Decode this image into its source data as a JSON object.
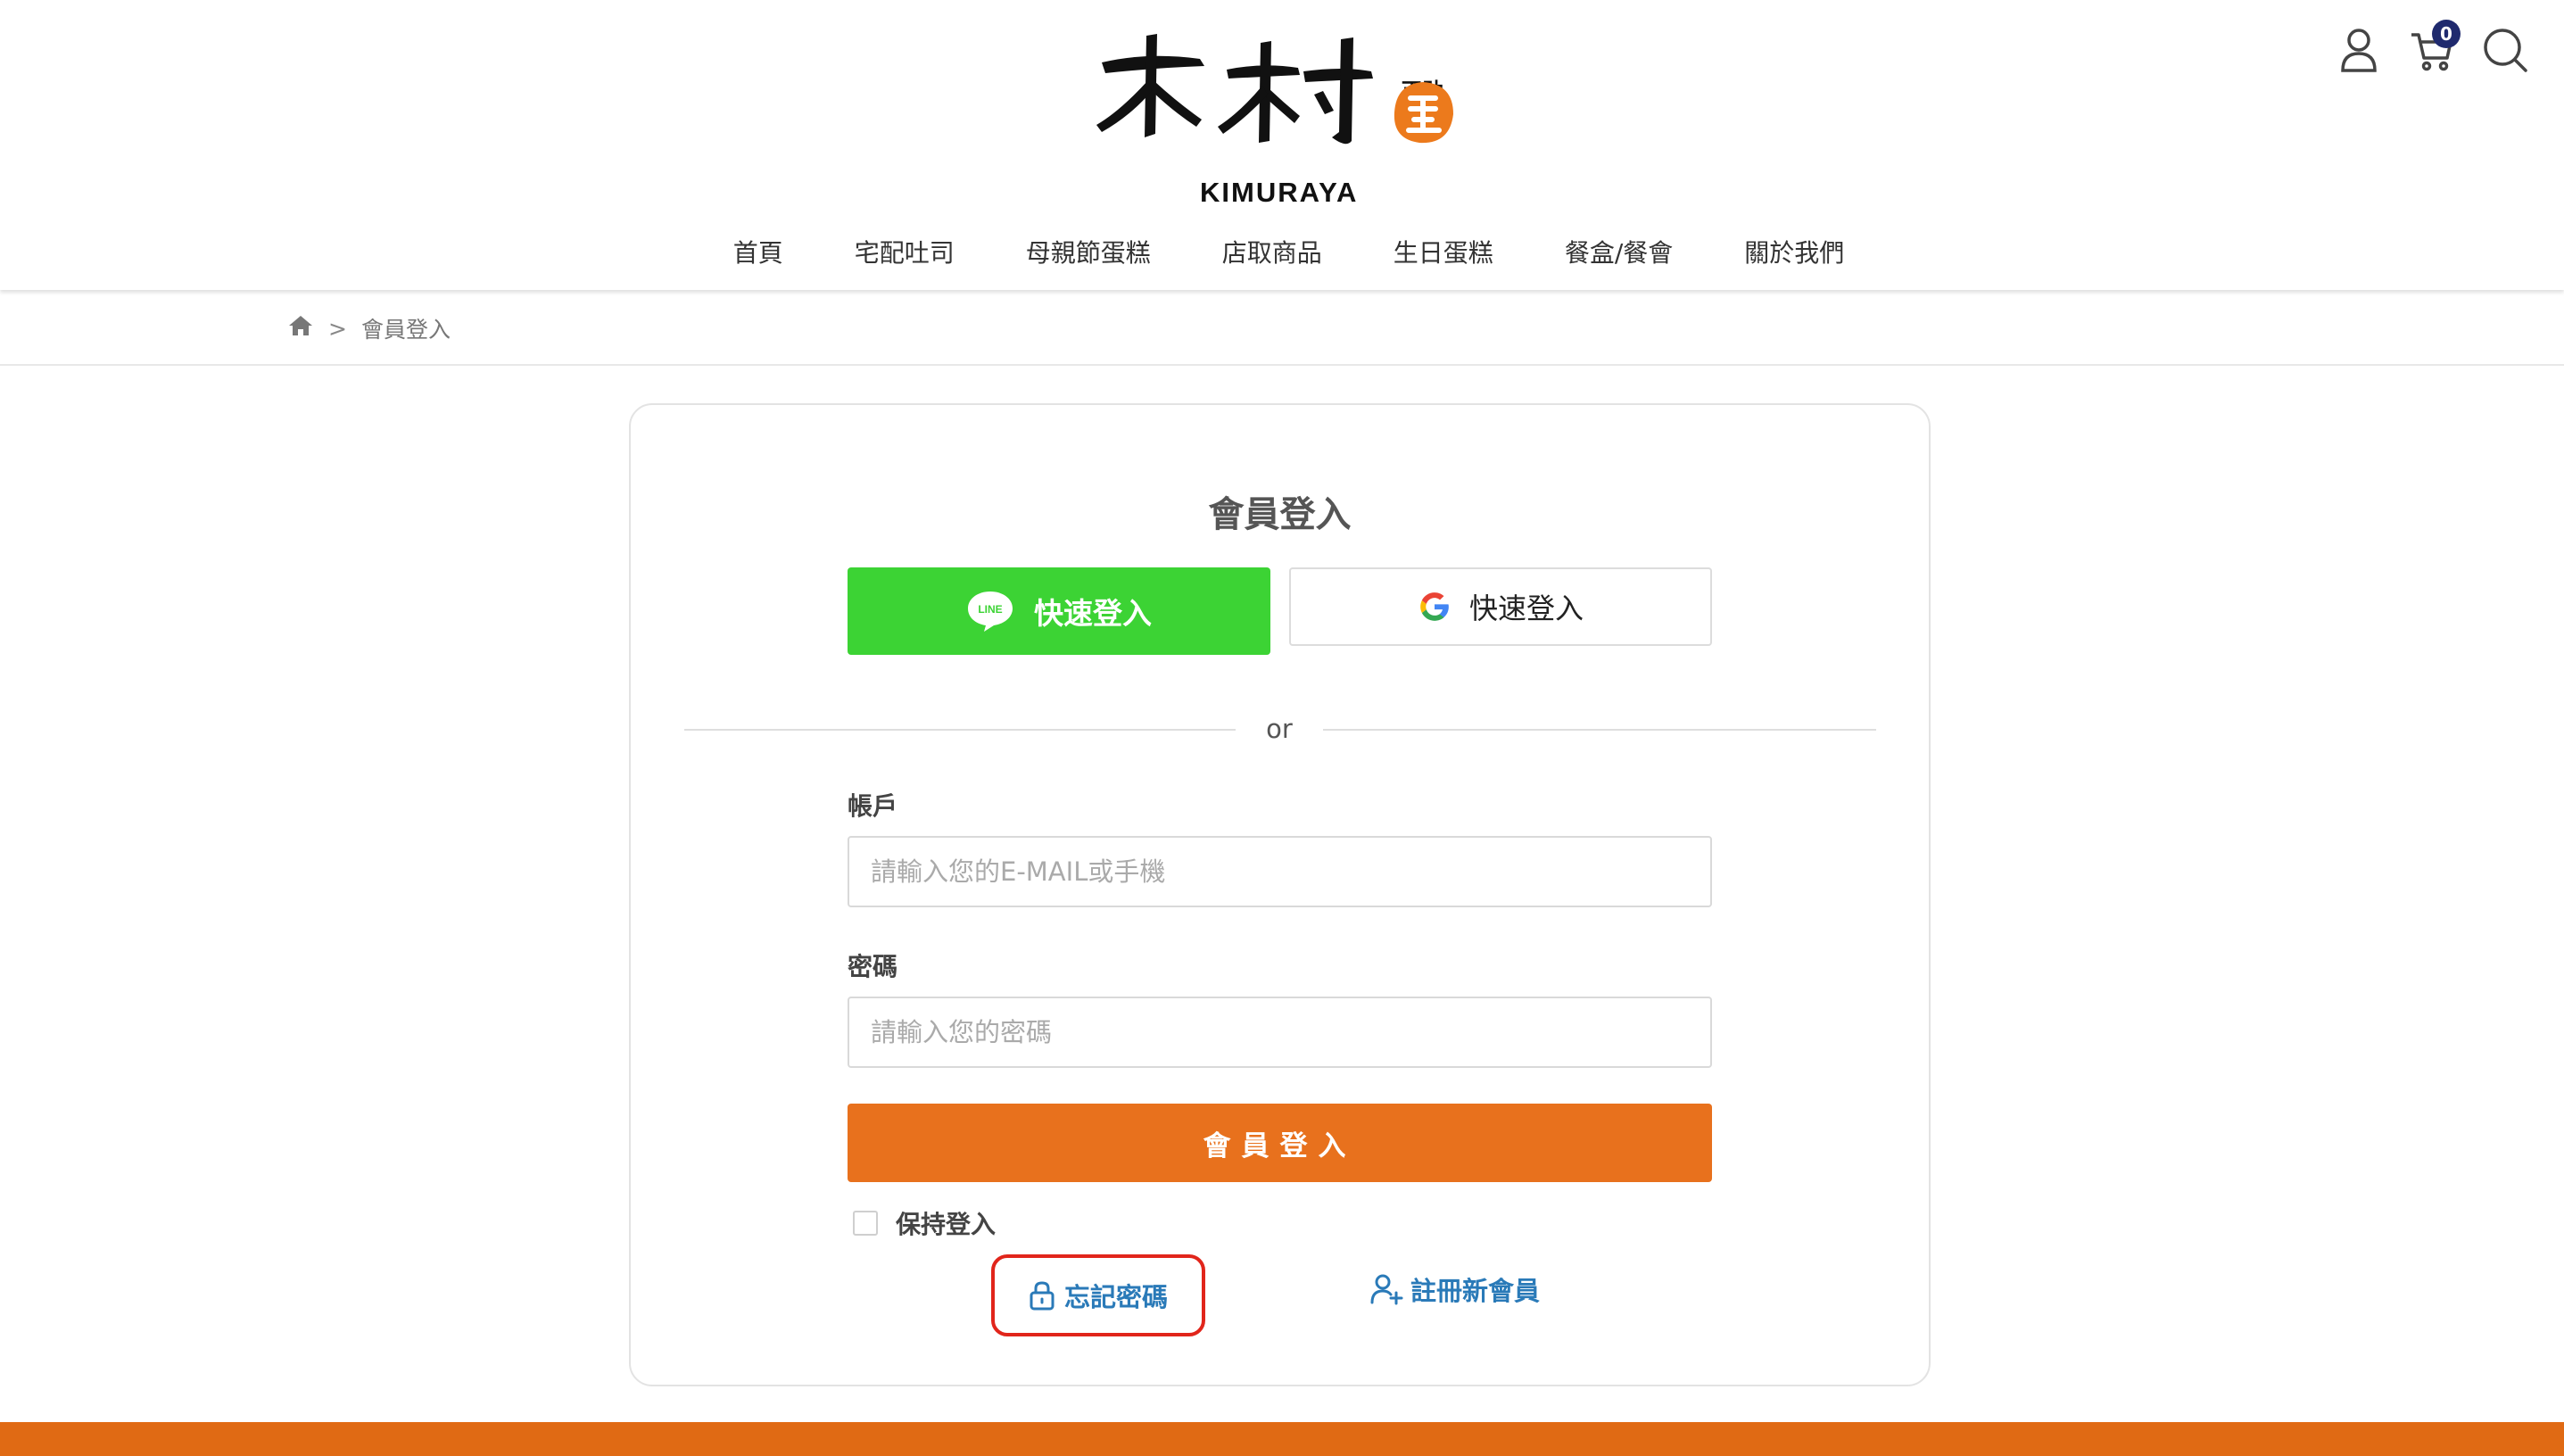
{
  "brand": {
    "logo_text": "KIMURAYA",
    "logo_small": "正助"
  },
  "header": {
    "cart_count": "0",
    "icons": [
      "user-icon",
      "cart-icon",
      "search-icon"
    ]
  },
  "nav": {
    "items": [
      {
        "label": "首頁"
      },
      {
        "label": "宅配吐司"
      },
      {
        "label": "母親節蛋糕"
      },
      {
        "label": "店取商品"
      },
      {
        "label": "生日蛋糕"
      },
      {
        "label": "餐盒/餐會"
      },
      {
        "label": "關於我們"
      }
    ]
  },
  "breadcrumb": {
    "separator": ">",
    "current": "會員登入"
  },
  "login": {
    "title": "會員登入",
    "line_button": "快速登入",
    "google_button": "快速登入",
    "divider": "or",
    "account_label": "帳戶",
    "account_placeholder": "請輸入您的E-MAIL或手機",
    "password_label": "密碼",
    "password_placeholder": "請輸入您的密碼",
    "submit": "會員登入",
    "keep_login": "保持登入",
    "forgot": "忘記密碼",
    "register": "註冊新會員"
  },
  "colors": {
    "line_green": "#3cd334",
    "accent_orange": "#e8711d",
    "link_blue": "#2a7ab8",
    "highlight_red": "#e1251b",
    "badge_navy": "#1f2a6e"
  }
}
